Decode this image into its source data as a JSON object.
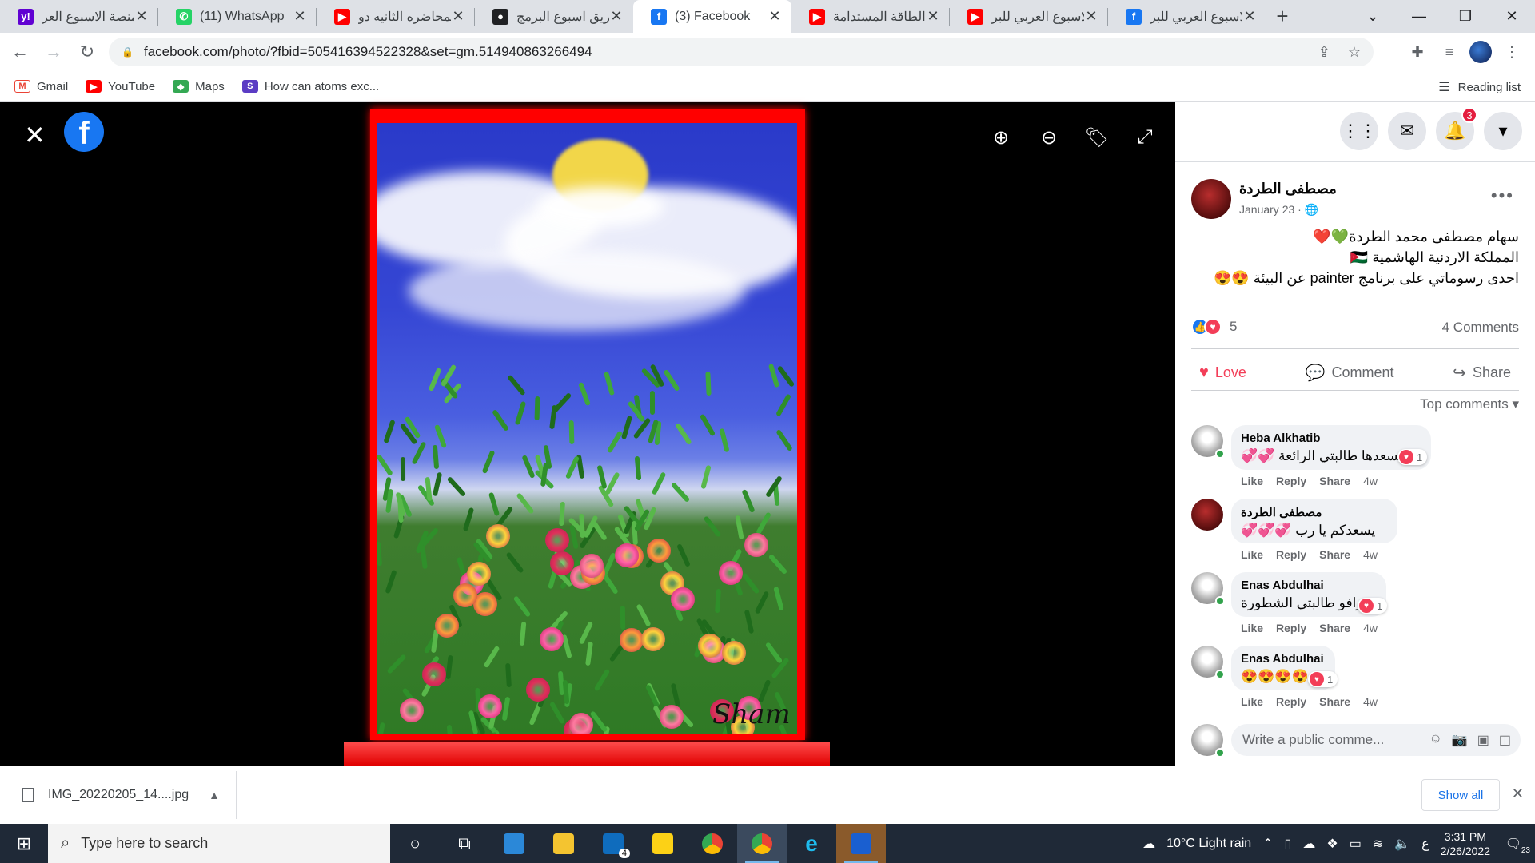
{
  "browser": {
    "tabs": [
      {
        "title": "منصة الاسبوع العر",
        "icon": "yahoo-icon"
      },
      {
        "title": "(11) WhatsApp",
        "icon": "whatsapp-icon"
      },
      {
        "title": "المحاضره الثانيه دو",
        "icon": "youtube-icon"
      },
      {
        "title": "فريق اسبوع البرمج",
        "icon": "brand-icon"
      },
      {
        "title": "(3) Facebook",
        "icon": "facebook-icon",
        "active": true
      },
      {
        "title": "الطاقة المستدامة",
        "icon": "youtube-icon"
      },
      {
        "title": "الاسبوع العربي للبر",
        "icon": "youtube-icon"
      },
      {
        "title": "الاسبوع العربي للبر",
        "icon": "facebook-icon"
      }
    ],
    "url": "facebook.com/photo/?fbid=505416394522328&set=gm.514940863266494",
    "bookmarks": [
      {
        "label": "Gmail"
      },
      {
        "label": "YouTube"
      },
      {
        "label": "Maps"
      },
      {
        "label": "How can atoms exc..."
      }
    ],
    "reading_list": "Reading list"
  },
  "viewer": {
    "signature": "Sham"
  },
  "panel": {
    "notification_count": "3",
    "post": {
      "author": "مصطفى الطردة",
      "date": "January 23 ·",
      "lines": [
        "سهام مصطفى محمد الطردة💚❤️",
        "المملكة الاردنية الهاشمية 🇯🇴",
        "احدى رسوماتي على برنامج painter عن البيئة 😍😍"
      ],
      "reaction_count": "5",
      "comment_count": "4 Comments",
      "actions": {
        "love": "Love",
        "comment": "Comment",
        "share": "Share"
      },
      "sort_label": "Top comments"
    },
    "comments": [
      {
        "name": "Heba Alkhatib",
        "text": "يسعدها طالبتي الرائعة 💞💞",
        "reaction_count": "1",
        "age": "4w"
      },
      {
        "name": "مصطفى الطردة",
        "text": "يسعدكم يا رب 💞💞💞",
        "reaction_count": "",
        "age": "4w"
      },
      {
        "name": "Enas Abdulhai",
        "text": "برافو طالبتي الشطورة",
        "reaction_count": "1",
        "age": "4w"
      },
      {
        "name": "Enas Abdulhai",
        "text": "😍😍😍😍",
        "reaction_count": "1",
        "age": "4w"
      }
    ],
    "comment_actions": {
      "like": "Like",
      "reply": "Reply",
      "share": "Share"
    },
    "write_placeholder": "Write a public comme..."
  },
  "downloads": {
    "file": "IMG_20220205_14....jpg",
    "show_all": "Show all"
  },
  "taskbar": {
    "search_placeholder": "Type here to search",
    "mail_badge": "4",
    "weather": "10°C  Light rain",
    "lang": "ع",
    "time": "3:31 PM",
    "date": "2/26/2022",
    "notification_count": "23"
  }
}
